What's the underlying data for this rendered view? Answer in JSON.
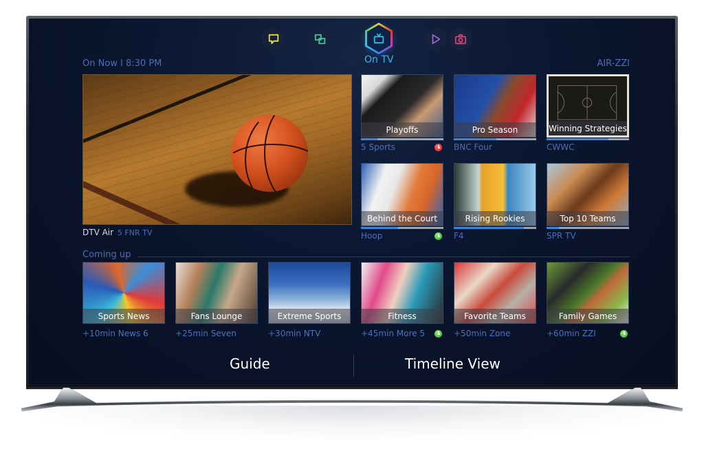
{
  "device": {
    "type": "television",
    "brand_context": "Smart TV hub"
  },
  "topnav": {
    "items": [
      {
        "id": "social",
        "icon": "chat-bubble-icon",
        "color": "#e8e23a",
        "active": false
      },
      {
        "id": "apps",
        "icon": "apps-squares-icon",
        "color": "#3fc4a8",
        "active": false
      },
      {
        "id": "on-tv",
        "icon": "tv-icon",
        "color": "#35bde8",
        "active": true,
        "label": "On TV"
      },
      {
        "id": "movies",
        "icon": "play-icon",
        "color": "#9b5fd6",
        "active": false
      },
      {
        "id": "photos",
        "icon": "camera-icon",
        "color": "#e0407a",
        "active": false
      }
    ],
    "active_label": "On TV"
  },
  "header": {
    "on_now": "On Now I 8:30 PM",
    "device_id": "AIR-ZZI"
  },
  "live": {
    "source": "DTV Air",
    "channel": "5 FNR TV"
  },
  "recommended": [
    {
      "title": "Playoffs",
      "channel": "5 Sports",
      "progress": 0.2,
      "status": "red",
      "status_icon": "clock-icon"
    },
    {
      "title": "Pro Season",
      "channel": "BNC Four",
      "progress": 0.52,
      "status": null
    },
    {
      "title": "Winning Strategies",
      "channel": "CWWC",
      "progress": 0.75,
      "status": null
    },
    {
      "title": "Behind the Court",
      "channel": "Hoop",
      "progress": 0.45,
      "status": "green",
      "status_icon": "clock-icon"
    },
    {
      "title": "Rising Rookies",
      "channel": "F4",
      "progress": 0.85,
      "status": null
    },
    {
      "title": "Top 10 Teams",
      "channel": "SPR TV",
      "progress": 0.15,
      "status": null
    }
  ],
  "coming_up": {
    "heading": "Coming up",
    "items": [
      {
        "title": "Sports News",
        "time": "+10min",
        "channel": "News 6",
        "status": null
      },
      {
        "title": "Fans Lounge",
        "time": "+25min",
        "channel": "Seven",
        "status": null
      },
      {
        "title": "Extreme Sports",
        "time": "+30min",
        "channel": "NTV",
        "status": null
      },
      {
        "title": "Fitness",
        "time": "+45min",
        "channel": "More 5",
        "status": "green"
      },
      {
        "title": "Favorite Teams",
        "time": "+50min",
        "channel": "Zone",
        "status": null
      },
      {
        "title": "Family Games",
        "time": "+60min",
        "channel": "ZZI",
        "status": "green"
      }
    ]
  },
  "footer": {
    "guide_label": "Guide",
    "timeline_label": "Timeline View"
  },
  "colors": {
    "accent_blue": "#4b70b8",
    "active_cyan": "#35bde8",
    "progress_fill": "#3f86d6",
    "progress_track": "#9ea4b0",
    "status_red": "#d21f2a",
    "status_green": "#2fa62c",
    "screen_bg": "#0b1630"
  }
}
